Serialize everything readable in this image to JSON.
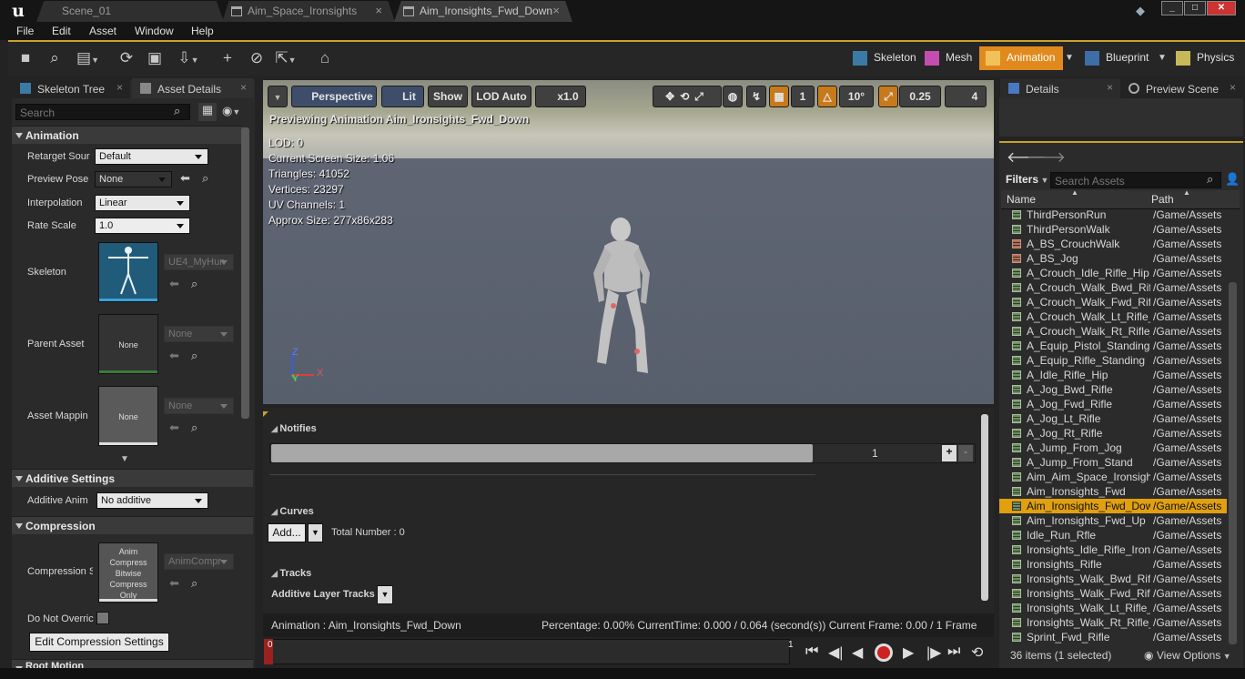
{
  "window": {
    "tabs": [
      {
        "label": "Scene_01"
      },
      {
        "label": "Aim_Space_Ironsights"
      },
      {
        "label": "Aim_Ironsights_Fwd_Down"
      }
    ],
    "controls": {
      "minimize": "_",
      "maximize": "□",
      "close": "✕"
    }
  },
  "menu": [
    "File",
    "Edit",
    "Asset",
    "Window",
    "Help"
  ],
  "modes": [
    "Skeleton",
    "Mesh",
    "Animation",
    "Blueprint",
    "Physics"
  ],
  "left": {
    "tabs": [
      "Skeleton Tree",
      "Asset Details"
    ],
    "search_placeholder": "Search",
    "animation": {
      "header": "Animation",
      "retarget_label": "Retarget Sour",
      "retarget_value": "Default",
      "preview_pose_label": "Preview Pose",
      "preview_pose_value": "None",
      "interpolation_label": "Interpolation",
      "interpolation_value": "Linear",
      "rate_scale_label": "Rate Scale",
      "rate_scale_value": "1.0",
      "skeleton_label": "Skeleton",
      "skeleton_value": "UE4_MyHun",
      "parent_label": "Parent Asset",
      "parent_thumb": "None",
      "parent_value": "None",
      "mapping_label": "Asset Mappin",
      "mapping_thumb": "None",
      "mapping_value": "None"
    },
    "additive": {
      "header": "Additive Settings",
      "label": "Additive Anim",
      "value": "No additive"
    },
    "compression": {
      "header": "Compression",
      "label": "Compression S",
      "thumb": [
        "Anim",
        "Compress",
        "Bitwise",
        "Compress",
        "Only"
      ],
      "value": "AnimCompr",
      "override_label": "Do Not Overric",
      "edit_button": "Edit Compression Settings"
    },
    "next_header": "Root Motion"
  },
  "viewport": {
    "perspective": "Perspective",
    "lit": "Lit",
    "show": "Show",
    "lod": "LOD Auto",
    "speed": "x1.0",
    "grid_snap": "1",
    "rot_snap": "10°",
    "scale_snap": "0.25",
    "camera_speed": "4",
    "preview_text": "Previewing Animation Aim_Ironsights_Fwd_Down",
    "stats": [
      "LOD: 0",
      "Current Screen Size: 1.06",
      "Triangles: 41052",
      "Vertices: 23297",
      "UV Channels: 1",
      "Approx Size: 277x86x283"
    ],
    "axes": {
      "z": "Z",
      "y": "Y",
      "x": "X"
    }
  },
  "sequencer": {
    "notifies": "Notifies",
    "notify_track": "1",
    "curves": "Curves",
    "add": "Add...",
    "total": "Total Number : 0",
    "tracks": "Tracks",
    "additive_tracks": "Additive Layer Tracks"
  },
  "status": {
    "animation": "Animation :  Aim_Ironsights_Fwd_Down",
    "percentage": "Percentage:  0.00% CurrentTime:  0.000 / 0.064 (second(s)) Current Frame:  0.00 / 1 Frame"
  },
  "timeline": {
    "start": "0",
    "end": "1"
  },
  "right": {
    "tabs": [
      "Details",
      "Preview Scene"
    ],
    "filters": "Filters",
    "search_placeholder": "Search Assets",
    "col_name": "Name",
    "col_path": "Path",
    "assets": [
      {
        "name": "ThirdPersonRun",
        "path": "/Game/Assets",
        "kind": "seq"
      },
      {
        "name": "ThirdPersonWalk",
        "path": "/Game/Assets",
        "kind": "seq"
      },
      {
        "name": "A_BS_CrouchWalk",
        "path": "/Game/Assets",
        "kind": "bs"
      },
      {
        "name": "A_BS_Jog",
        "path": "/Game/Assets",
        "kind": "bs"
      },
      {
        "name": "A_Crouch_Idle_Rifle_Hip",
        "path": "/Game/Assets",
        "kind": "seq"
      },
      {
        "name": "A_Crouch_Walk_Bwd_Rifl",
        "path": "/Game/Assets",
        "kind": "seq"
      },
      {
        "name": "A_Crouch_Walk_Fwd_Rifl",
        "path": "/Game/Assets",
        "kind": "seq"
      },
      {
        "name": "A_Crouch_Walk_Lt_Rifle_",
        "path": "/Game/Assets",
        "kind": "seq"
      },
      {
        "name": "A_Crouch_Walk_Rt_Rifle_",
        "path": "/Game/Assets",
        "kind": "seq"
      },
      {
        "name": "A_Equip_Pistol_Standing",
        "path": "/Game/Assets",
        "kind": "seq"
      },
      {
        "name": "A_Equip_Rifle_Standing",
        "path": "/Game/Assets",
        "kind": "seq"
      },
      {
        "name": "A_Idle_Rifle_Hip",
        "path": "/Game/Assets",
        "kind": "seq"
      },
      {
        "name": "A_Jog_Bwd_Rifle",
        "path": "/Game/Assets",
        "kind": "seq"
      },
      {
        "name": "A_Jog_Fwd_Rifle",
        "path": "/Game/Assets",
        "kind": "seq"
      },
      {
        "name": "A_Jog_Lt_Rifle",
        "path": "/Game/Assets",
        "kind": "seq"
      },
      {
        "name": "A_Jog_Rt_Rifle",
        "path": "/Game/Assets",
        "kind": "seq"
      },
      {
        "name": "A_Jump_From_Jog",
        "path": "/Game/Assets",
        "kind": "seq"
      },
      {
        "name": "A_Jump_From_Stand",
        "path": "/Game/Assets",
        "kind": "seq"
      },
      {
        "name": "Aim_Aim_Space_Ironsigh",
        "path": "/Game/Assets",
        "kind": "seq"
      },
      {
        "name": "Aim_Ironsights_Fwd",
        "path": "/Game/Assets",
        "kind": "seq"
      },
      {
        "name": "Aim_Ironsights_Fwd_Dow",
        "path": "/Game/Assets",
        "kind": "seq",
        "selected": true
      },
      {
        "name": "Aim_Ironsights_Fwd_Up",
        "path": "/Game/Assets",
        "kind": "seq"
      },
      {
        "name": "Idle_Run_Rfle",
        "path": "/Game/Assets",
        "kind": "seq"
      },
      {
        "name": "Ironsights_Idle_Rifle_Iron",
        "path": "/Game/Assets",
        "kind": "seq"
      },
      {
        "name": "Ironsights_Rifle",
        "path": "/Game/Assets",
        "kind": "seq"
      },
      {
        "name": "Ironsights_Walk_Bwd_Rif",
        "path": "/Game/Assets",
        "kind": "seq"
      },
      {
        "name": "Ironsights_Walk_Fwd_Rif",
        "path": "/Game/Assets",
        "kind": "seq"
      },
      {
        "name": "Ironsights_Walk_Lt_Rifle_",
        "path": "/Game/Assets",
        "kind": "seq"
      },
      {
        "name": "Ironsights_Walk_Rt_Rifle_",
        "path": "/Game/Assets",
        "kind": "seq"
      },
      {
        "name": "Sprint_Fwd_Rifle",
        "path": "/Game/Assets",
        "kind": "seq"
      }
    ],
    "count": "36 items (1 selected)",
    "view_options": "View Options"
  }
}
